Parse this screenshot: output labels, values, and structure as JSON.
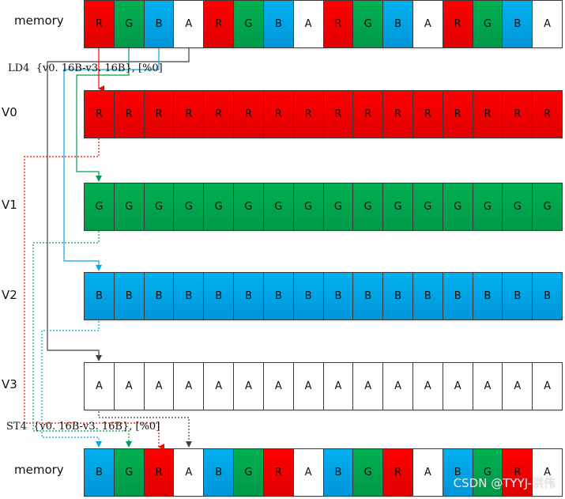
{
  "labels": {
    "memory_top": "memory",
    "v0": "V0",
    "v1": "V1",
    "v2": "V2",
    "v3": "V3",
    "memory_bottom": "memory"
  },
  "instructions": {
    "load": "LD4  {v0. 16B-v3. 16B}, [%0]",
    "store": "ST4  {v0. 16B-v3. 16B}, [%0]"
  },
  "rows": {
    "memory_top": [
      "R",
      "G",
      "B",
      "A",
      "R",
      "G",
      "B",
      "A",
      "R",
      "G",
      "B",
      "A",
      "R",
      "G",
      "B",
      "A"
    ],
    "v0": [
      "R",
      "R",
      "R",
      "R",
      "R",
      "R",
      "R",
      "R",
      "R",
      "R",
      "R",
      "R",
      "R",
      "R",
      "R",
      "R"
    ],
    "v1": [
      "G",
      "G",
      "G",
      "G",
      "G",
      "G",
      "G",
      "G",
      "G",
      "G",
      "G",
      "G",
      "G",
      "G",
      "G",
      "G"
    ],
    "v2": [
      "B",
      "B",
      "B",
      "B",
      "B",
      "B",
      "B",
      "B",
      "B",
      "B",
      "B",
      "B",
      "B",
      "B",
      "B",
      "B"
    ],
    "v3": [
      "A",
      "A",
      "A",
      "A",
      "A",
      "A",
      "A",
      "A",
      "A",
      "A",
      "A",
      "A",
      "A",
      "A",
      "A",
      "A"
    ],
    "memory_bottom": [
      "B",
      "G",
      "R",
      "A",
      "B",
      "G",
      "R",
      "A",
      "B",
      "G",
      "R",
      "A",
      "B",
      "G",
      "R",
      "A"
    ]
  },
  "colors": {
    "R": "#ff0000",
    "G": "#00b050",
    "B": "#00b0f0",
    "A": "#ffffff",
    "load_R": "#ff0000",
    "load_G": "#00a050",
    "load_B": "#00a8e8",
    "load_A": "#404040"
  },
  "watermark": "CSDN @TYYJ-洪伟"
}
